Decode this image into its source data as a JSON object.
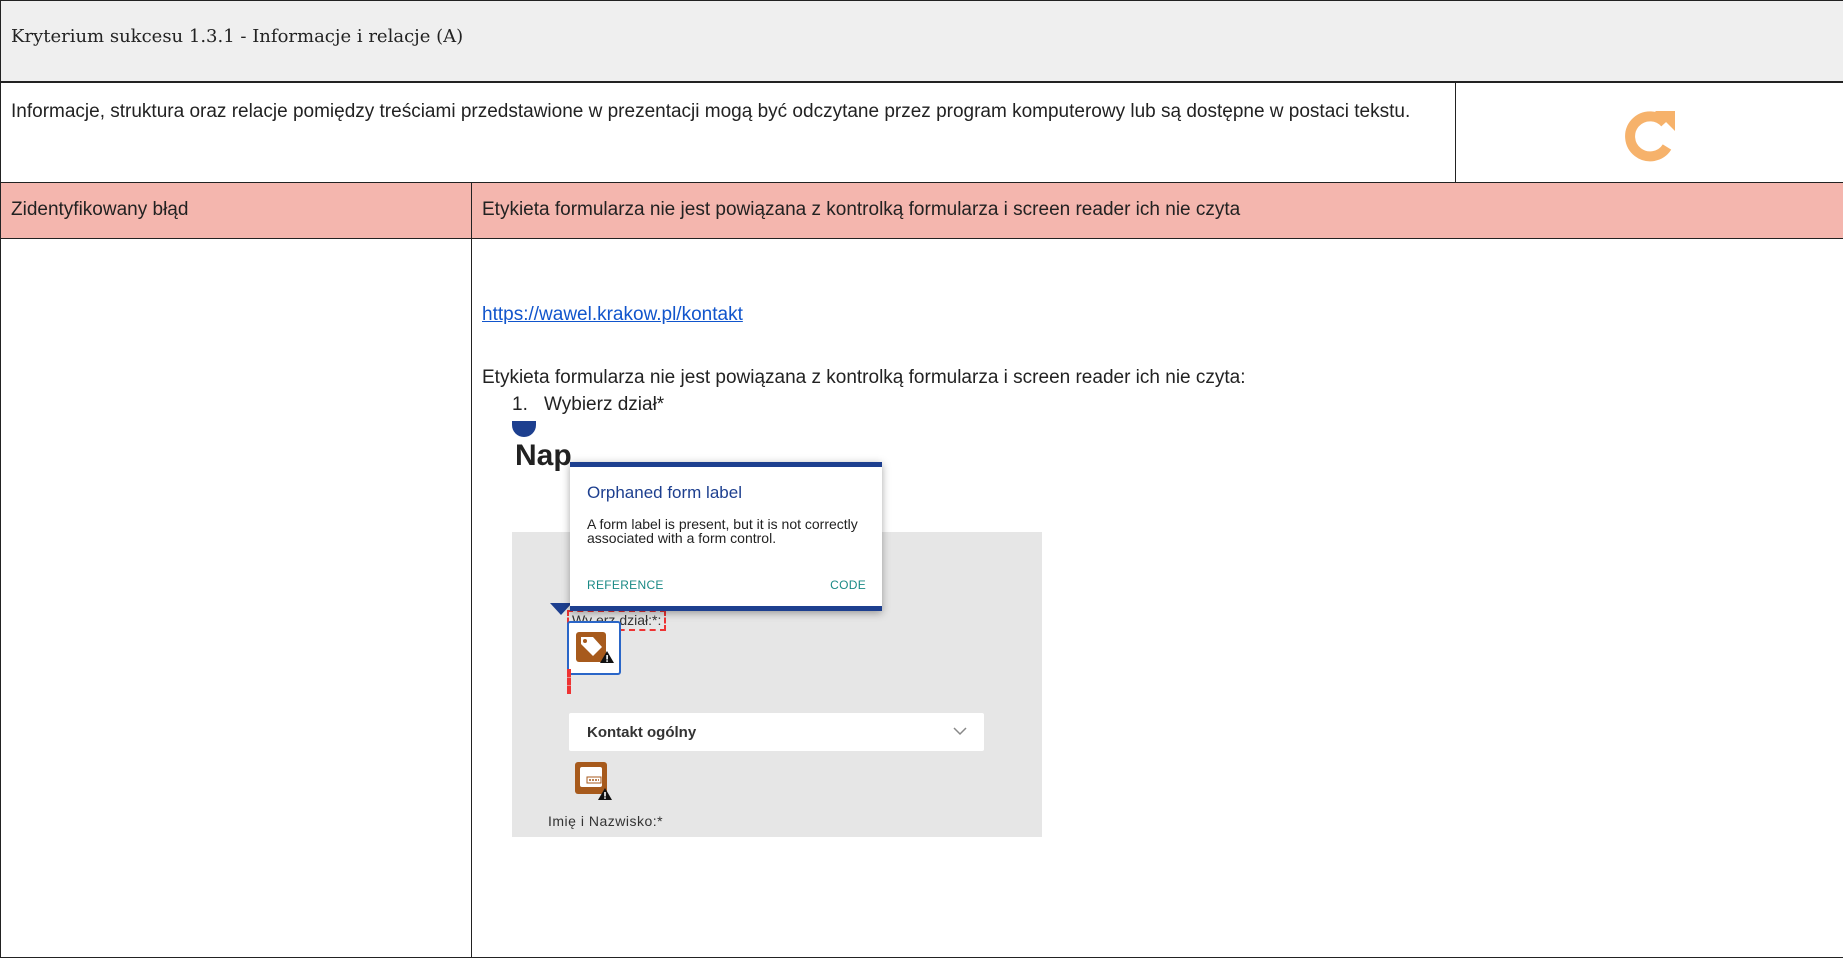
{
  "header": {
    "title": "Kryterium sukcesu 1.3.1 - Informacje i relacje (A)"
  },
  "criterion": {
    "description": "Informacje, struktura oraz relacje pomiędzy treściami przedstawione w prezentacji mogą być odczytane przez program komputerowy lub są dostępne w postaci tekstu.",
    "status_icon": "redo-arrow-icon",
    "status_color": "#f6b26b"
  },
  "error": {
    "label": "Zidentyfikowany błąd",
    "value": "Etykieta formularza nie jest powiązana z kontrolką formularza i screen reader ich nie czyta",
    "row_color": "#f4b6ae"
  },
  "details": {
    "link": "https://wawel.krakow.pl/kontakt",
    "description": "Etykieta formularza nie jest powiązana z kontrolką formularza i screen reader ich nie czyta:",
    "list": [
      {
        "number": "1.",
        "text": "Wybierz dział*"
      }
    ]
  },
  "screenshot": {
    "heading": "Nap",
    "field_label_partial": "Wy   erz dział:*:",
    "dropdown_value": "Kontakt ogólny",
    "name_label": "Imię i Nazwisko:*",
    "popup": {
      "title": "Orphaned form label",
      "body": "A form label is present, but it is not correctly associated with a form control.",
      "reference": "REFERENCE",
      "code": "CODE"
    }
  }
}
